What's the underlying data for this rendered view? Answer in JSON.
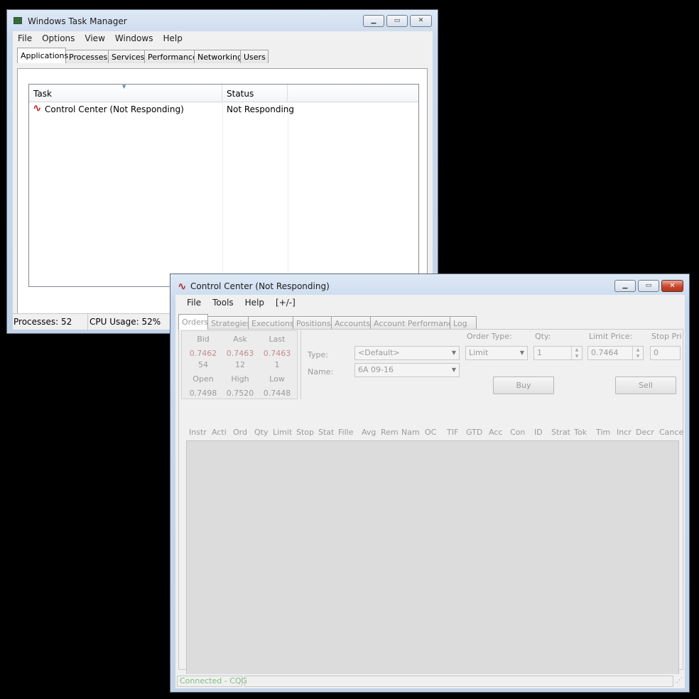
{
  "task_manager": {
    "title": "Windows Task Manager",
    "menu": [
      "File",
      "Options",
      "View",
      "Windows",
      "Help"
    ],
    "tabs": [
      "Applications",
      "Processes",
      "Services",
      "Performance",
      "Networking",
      "Users"
    ],
    "active_tab": "Applications",
    "columns": {
      "task": "Task",
      "status": "Status"
    },
    "rows": [
      {
        "task": "Control Center (Not Responding)",
        "status": "Not Responding"
      }
    ],
    "status": {
      "processes": "Processes: 52",
      "cpu": "CPU Usage: 52%"
    }
  },
  "control_center": {
    "title": "Control Center (Not Responding)",
    "menu": [
      "File",
      "Tools",
      "Help",
      "[+/-]"
    ],
    "tabs": [
      "Orders",
      "Strategies",
      "Executions",
      "Positions",
      "Accounts",
      "Account Performance",
      "Log"
    ],
    "active_tab": "Orders",
    "quote": {
      "bid_label": "Bid",
      "ask_label": "Ask",
      "last_label": "Last",
      "bid": "0.7462",
      "ask": "0.7463",
      "last": "0.7463",
      "bid_size": "54",
      "ask_size": "12",
      "last_size": "1",
      "open_label": "Open",
      "high_label": "High",
      "low_label": "Low",
      "open": "0.7498",
      "high": "0.7520",
      "low": "0.7448"
    },
    "order_entry": {
      "type_label": "Type:",
      "type_value": "<Default>",
      "name_label": "Name:",
      "name_value": "6A 09-16",
      "order_type_label": "Order Type:",
      "order_type_value": "Limit",
      "qty_label": "Qty:",
      "qty_value": "1",
      "limit_price_label": "Limit Price:",
      "limit_price_value": "0.7464",
      "stop_price_label": "Stop Pri",
      "stop_price_value": "0",
      "buy_label": "Buy",
      "sell_label": "Sell"
    },
    "order_columns": [
      "Instr",
      "Acti",
      "Ord",
      "Qty",
      "Limit",
      "Stop",
      "Stat",
      "Fille",
      "Avg",
      "Rem",
      "Nam",
      "OC",
      "TIF",
      "GTD",
      "Acc",
      "Con",
      "ID",
      "Strat",
      "Tok",
      "Tim",
      "Incr",
      "Decr",
      "Cance"
    ],
    "status_text": "Connected - CQG"
  },
  "colors": {
    "sell_red": "#c0392b",
    "connected_green": "#7fbf7f",
    "app_icon": "#b12b2b"
  },
  "icons": {
    "task_manager": "monitor-icon",
    "app": "control-center-icon"
  }
}
